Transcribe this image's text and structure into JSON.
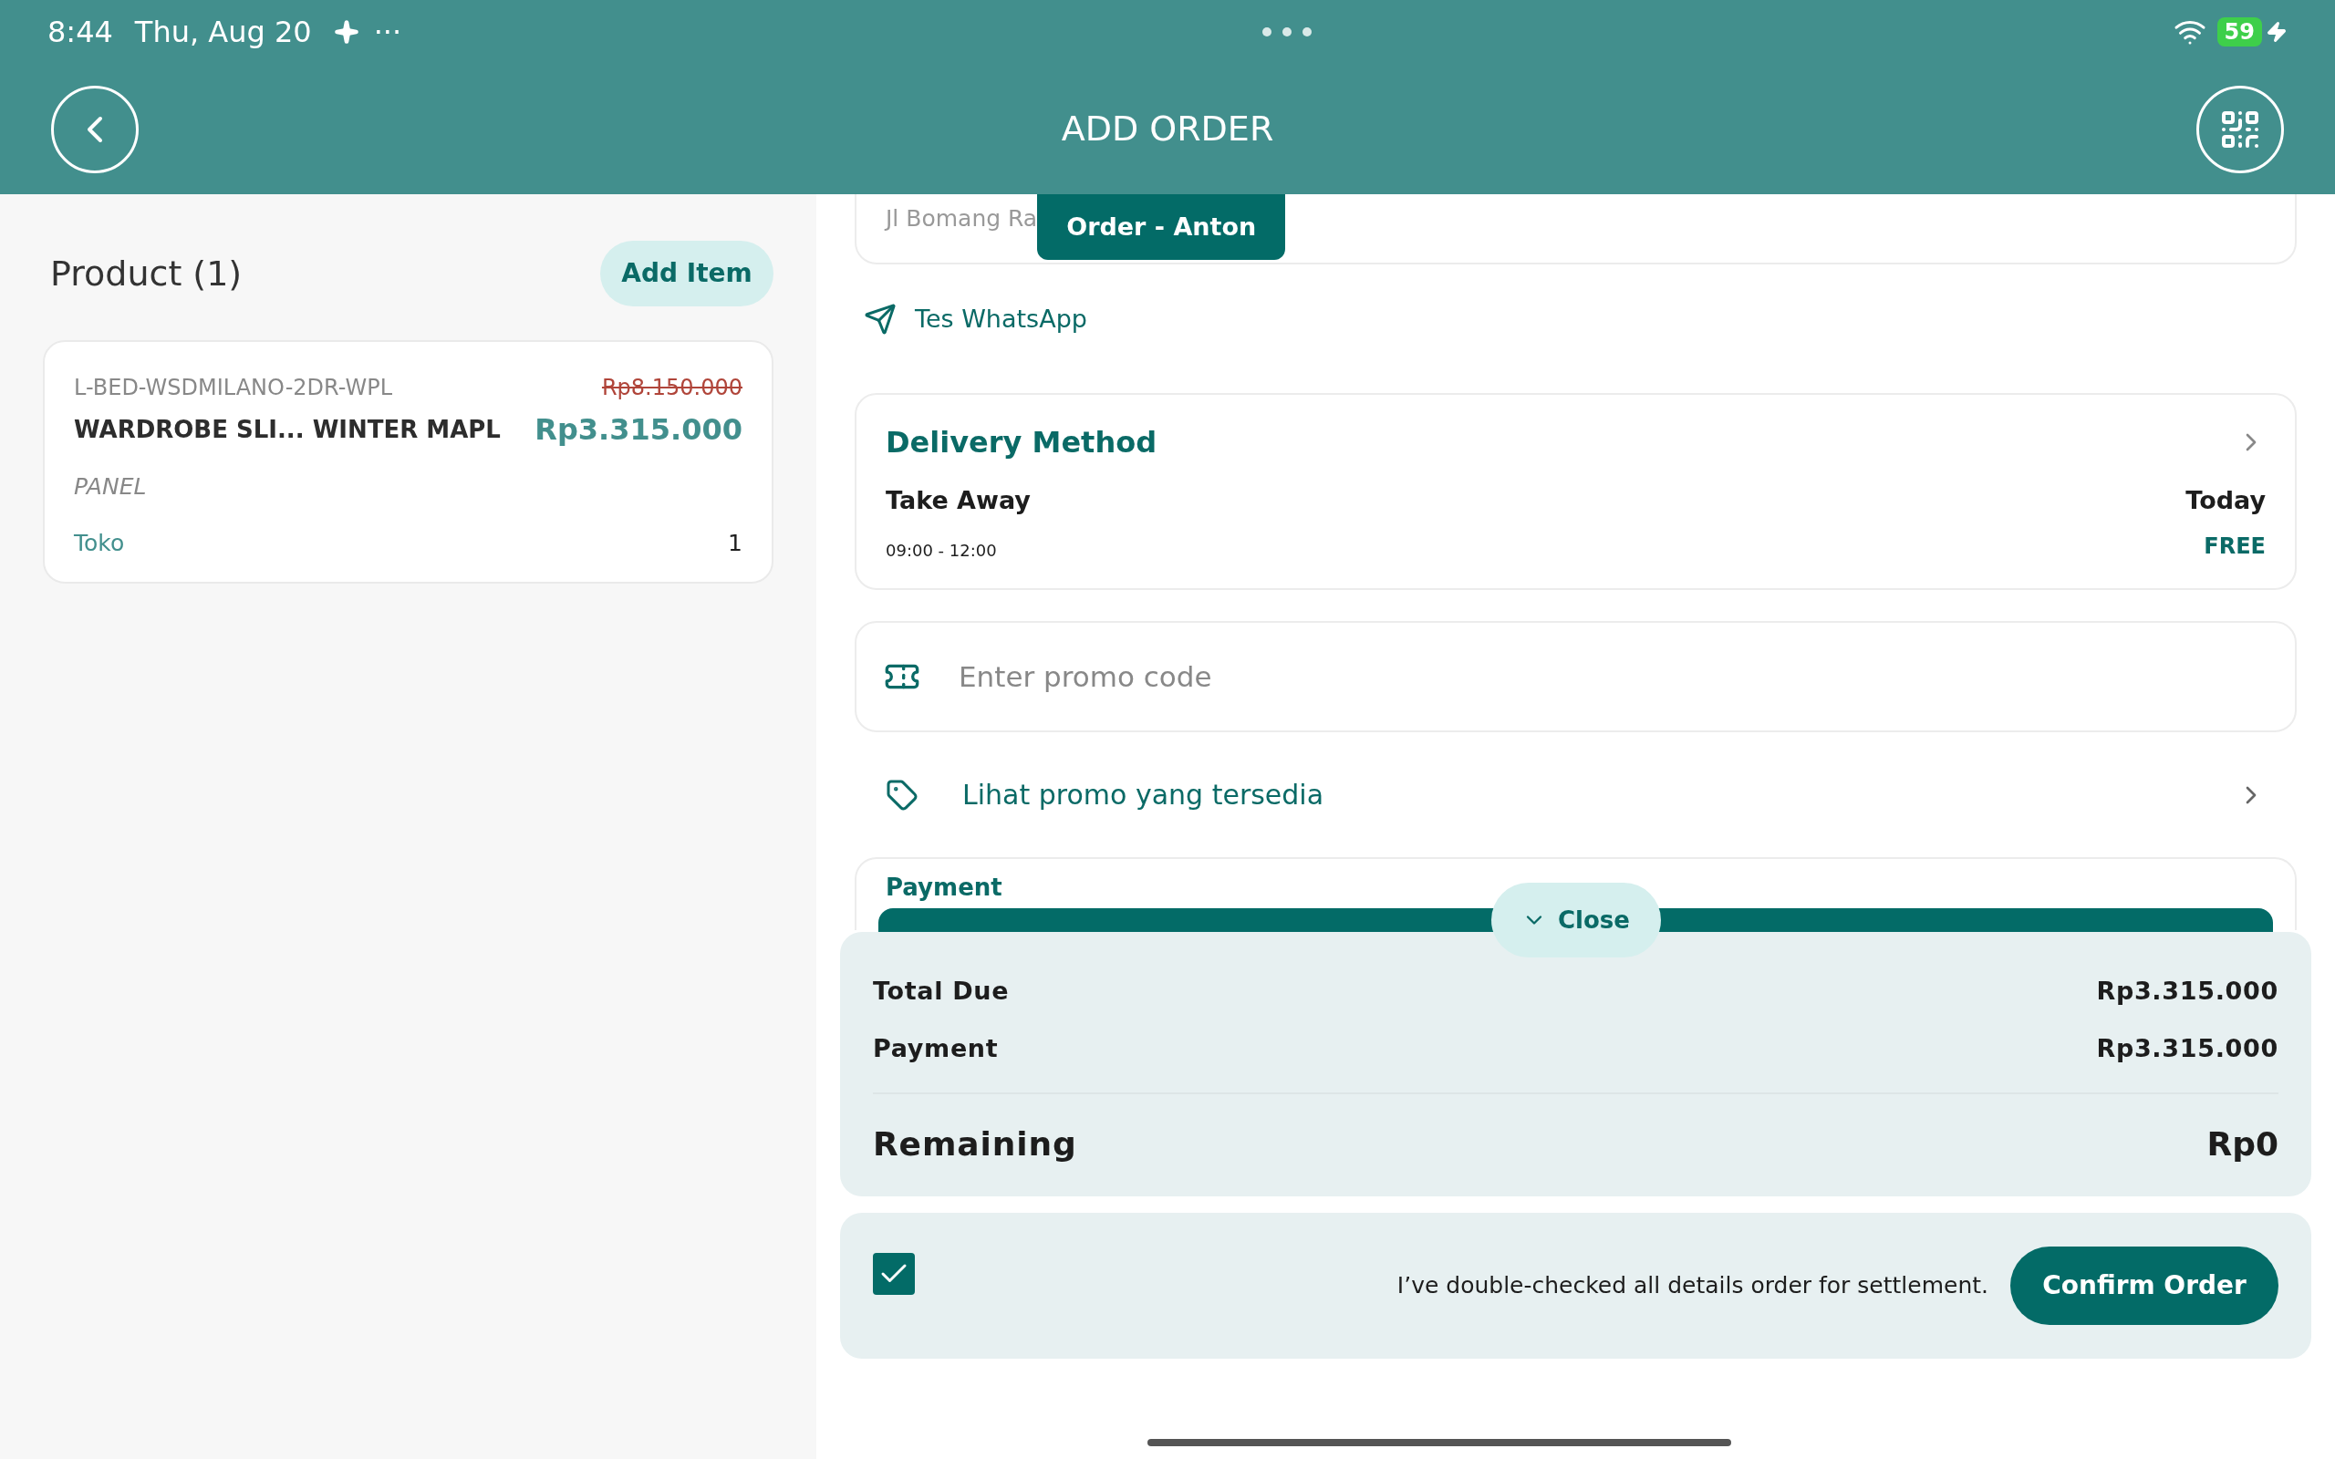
{
  "status_bar": {
    "time": "8:44",
    "date": "Thu, Aug 20",
    "more": "···",
    "battery": "59"
  },
  "header": {
    "title": "ADD ORDER"
  },
  "products": {
    "title": "Product (1)",
    "add_button": "Add Item",
    "items": [
      {
        "sku": "L-BED-WSDMILANO-2DR-WPL",
        "original_price": "Rp8.150.000",
        "name": "WARDROBE SLI... WINTER MAPL",
        "price": "Rp3.315.000",
        "category": "PANEL",
        "store": "Toko",
        "quantity": "1"
      }
    ]
  },
  "address": {
    "text": "Jl Bomang Ra",
    "order_tab": "Order - Anton"
  },
  "whatsapp_link": "Tes WhatsApp",
  "delivery": {
    "title": "Delivery Method",
    "method": "Take Away",
    "time": "09:00 - 12:00",
    "day": "Today",
    "fee": "FREE"
  },
  "promo": {
    "placeholder": "Enter promo code",
    "link": "Lihat promo yang tersedia"
  },
  "payment": {
    "title": "Payment",
    "close_button": "Close",
    "rows": [
      {
        "label": "Total Due",
        "value": "Rp3.315.000"
      },
      {
        "label": "Payment",
        "value": "Rp3.315.000"
      }
    ],
    "remaining": {
      "label": "Remaining",
      "value": "Rp0"
    }
  },
  "confirm": {
    "checked": true,
    "text": "I’ve double-checked all details order for settlement.",
    "button": "Confirm Order"
  }
}
